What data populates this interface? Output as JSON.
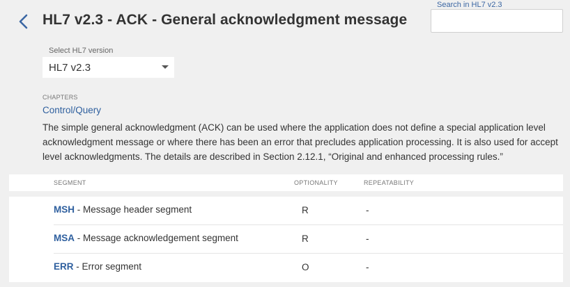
{
  "header": {
    "title": "HL7 v2.3 - ACK - General acknowledgment message",
    "back_icon": "chevron-left-icon"
  },
  "search": {
    "label": "Search in HL7 v2.3",
    "value": "",
    "placeholder": ""
  },
  "version_select": {
    "label": "Select HL7 version",
    "value": "HL7 v2.3"
  },
  "chapters": {
    "label": "CHAPTERS",
    "link": "Control/Query",
    "description": "The simple general acknowledgment (ACK) can be used where the application does not define a special application level acknowledgment message or where there has been an error that precludes application processing. It is also used for accept level acknowledgments. The details are described in Section 2.12.1, “Original and enhanced processing rules.”"
  },
  "table": {
    "columns": [
      "SEGMENT",
      "OPTIONALITY",
      "REPEATABILITY"
    ],
    "rows": [
      {
        "code": "MSH",
        "name": " - Message header segment",
        "optionality": "R",
        "repeatability": "-"
      },
      {
        "code": "MSA",
        "name": " - Message acknowledgement segment",
        "optionality": "R",
        "repeatability": "-"
      },
      {
        "code": "ERR",
        "name": " - Error segment",
        "optionality": "O",
        "repeatability": "-"
      }
    ]
  },
  "colors": {
    "accent": "#2e5f9e",
    "background": "#f0f0f0"
  }
}
